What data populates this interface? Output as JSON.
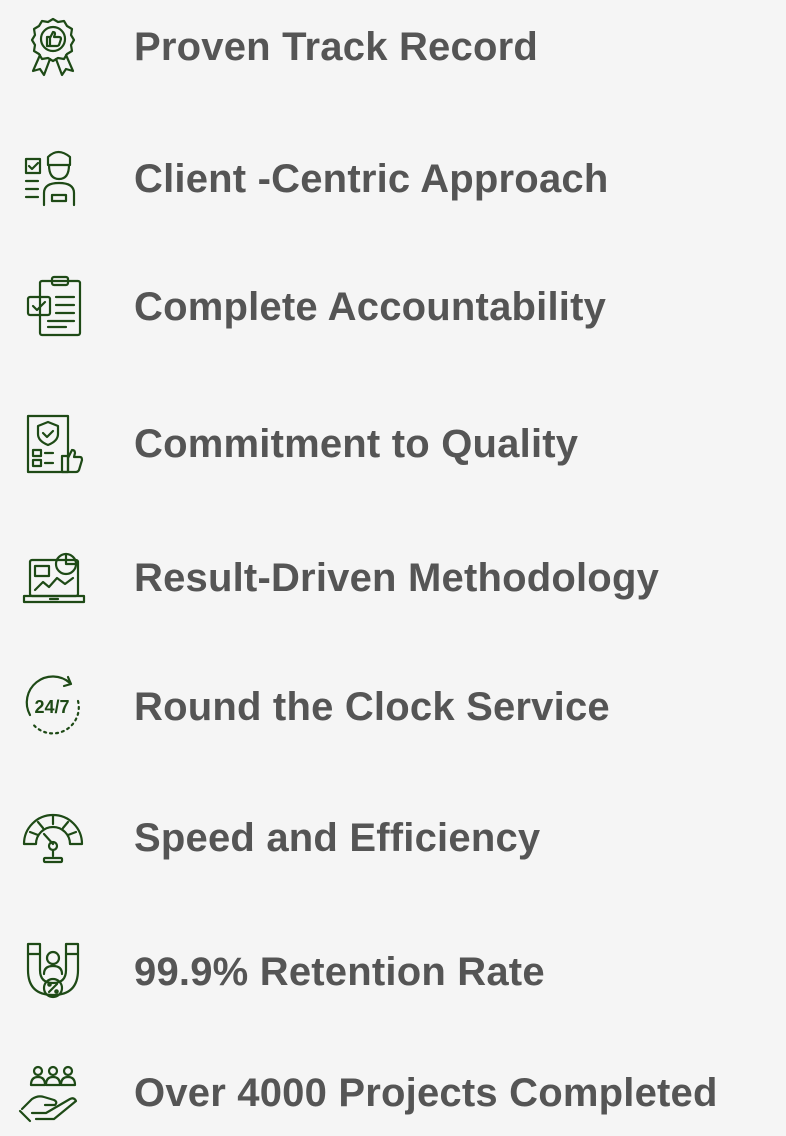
{
  "theme": {
    "icon_color": "#1e4a16",
    "text_color": "#555555",
    "background": "#f5f5f5"
  },
  "features": [
    {
      "label": "Proven Track Record",
      "icon": "award-thumbs-up-icon"
    },
    {
      "label": "Client -Centric Approach",
      "icon": "client-checklist-icon"
    },
    {
      "label": "Complete Accountability",
      "icon": "clipboard-check-icon"
    },
    {
      "label": "Commitment to Quality",
      "icon": "quality-shield-thumbs-up-icon"
    },
    {
      "label": "Result-Driven Methodology",
      "icon": "laptop-analytics-icon"
    },
    {
      "label": "Round the Clock Service",
      "icon": "clock-24-7-icon"
    },
    {
      "label": "Speed and Efficiency",
      "icon": "speedometer-icon"
    },
    {
      "label": "99.9% Retention Rate",
      "icon": "magnet-retention-icon"
    },
    {
      "label": "Over 4000 Projects Completed",
      "icon": "hand-team-icon"
    }
  ]
}
